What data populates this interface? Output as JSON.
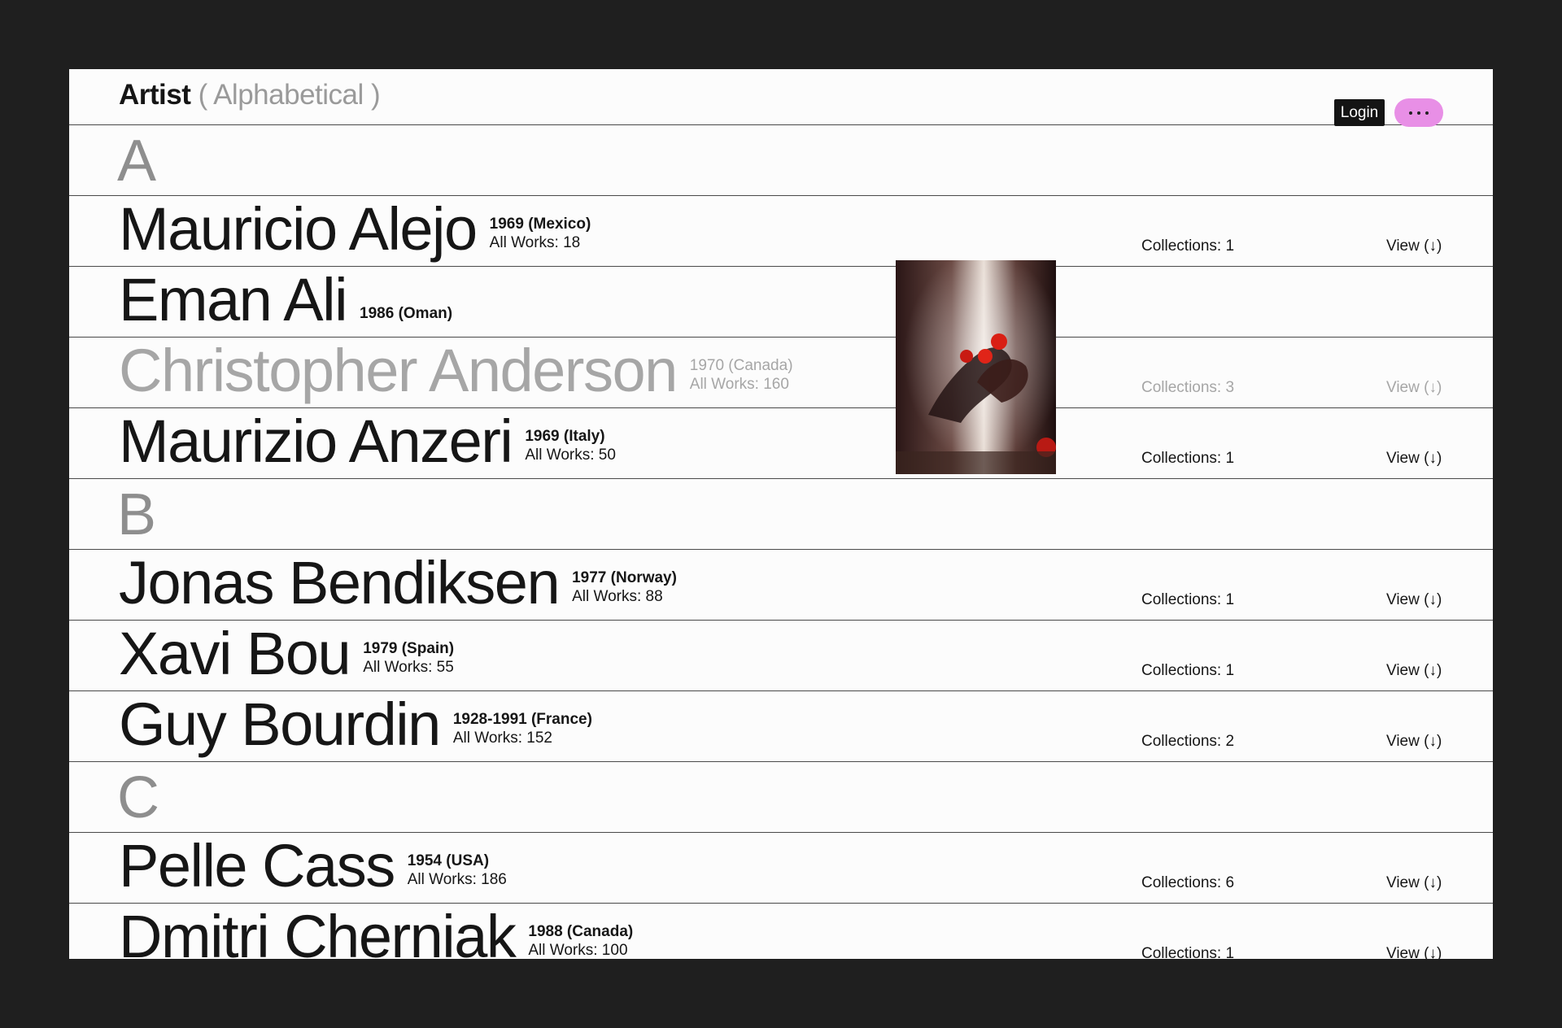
{
  "header": {
    "title": "Artist",
    "subtitle": "( Alphabetical )",
    "login_label": "Login",
    "menu_color": "#e88fe6"
  },
  "sections": [
    {
      "letter": "A",
      "artists": [
        {
          "name": "Mauricio Alejo",
          "years": "1969 (Mexico)",
          "works": "All Works: 18",
          "collections": "Collections: 1",
          "view": "View (↓)"
        },
        {
          "name": "Eman Ali",
          "years": "1986 (Oman)"
        },
        {
          "name": "Christopher Anderson",
          "years": "1970 (Canada)",
          "works": "All Works: 160",
          "collections": "Collections: 3",
          "view": "View (↓)",
          "dim": true
        },
        {
          "name": "Maurizio Anzeri",
          "years": "1969 (Italy)",
          "works": "All Works: 50",
          "collections": "Collections: 1",
          "view": "View (↓)"
        }
      ]
    },
    {
      "letter": "B",
      "artists": [
        {
          "name": "Jonas Bendiksen",
          "years": "1977 (Norway)",
          "works": "All Works: 88",
          "collections": "Collections: 1",
          "view": "View (↓)"
        },
        {
          "name": "Xavi Bou",
          "years": "1979 (Spain)",
          "works": "All Works: 55",
          "collections": "Collections: 1",
          "view": "View (↓)"
        },
        {
          "name": "Guy Bourdin",
          "years": "1928-1991 (France)",
          "works": "All Works: 152",
          "collections": "Collections: 2",
          "view": "View (↓)"
        }
      ]
    },
    {
      "letter": "C",
      "artists": [
        {
          "name": "Pelle Cass",
          "years": "1954 (USA)",
          "works": "All Works: 186",
          "collections": "Collections: 6",
          "view": "View (↓)"
        },
        {
          "name": "Dmitri Cherniak",
          "years": "1988 (Canada)",
          "works": "All Works: 100",
          "collections": "Collections: 1",
          "view": "View (↓)"
        }
      ]
    }
  ]
}
